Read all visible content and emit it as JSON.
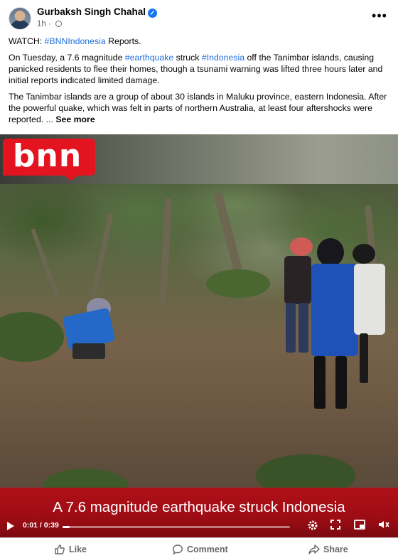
{
  "post": {
    "author": "Gurbaksh Singh Chahal",
    "time": "1h",
    "menu_glyph": "•••",
    "line1": {
      "prefix": "WATCH: ",
      "hashtag": "#BNNIndonesia",
      "suffix": " Reports."
    },
    "para1": {
      "a": "On Tuesday, a 7.6 magnitude ",
      "tag1": "#earthquake",
      "b": " struck ",
      "tag2": "#Indonesia",
      "c": " off the Tanimbar islands, causing panicked residents to flee their homes, though a tsunami warning was lifted three hours later and initial reports indicated limited damage."
    },
    "para2": {
      "text": "The Tanimbar islands are a group of about 30 islands in Maluku province, eastern Indonesia. After the powerful quake, which was felt in parts of northern Australia, at least four aftershocks were reported. ... ",
      "see_more": "See more"
    }
  },
  "video": {
    "logo_text": "bnn",
    "subtitle": "A 7.6 magnitude earthquake struck Indonesia",
    "time_display": "0:01 / 0:39",
    "progress_fraction": 0.03,
    "icons": [
      "play-icon",
      "settings-icon",
      "fullscreen-icon",
      "picture-in-picture-icon",
      "mute-icon"
    ]
  },
  "actions": {
    "like": "Like",
    "comment": "Comment",
    "share": "Share"
  },
  "colors": {
    "link": "#216fdb",
    "verified": "#1877f2",
    "brand_red": "#e3141f",
    "muted": "#65676b"
  }
}
